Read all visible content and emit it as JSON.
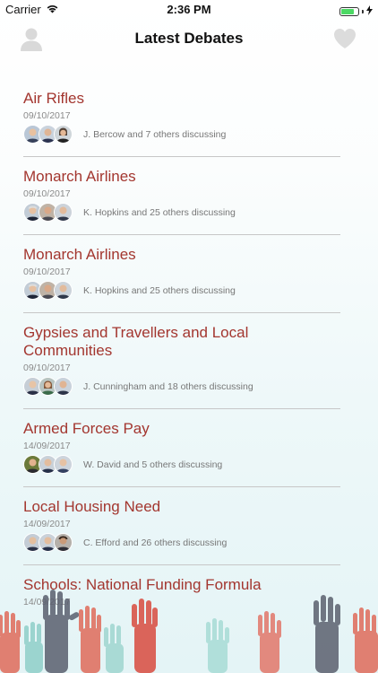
{
  "status_bar": {
    "carrier": "Carrier",
    "time": "2:36 PM",
    "battery_level": 0.8,
    "battery_color": "#4cd964"
  },
  "nav": {
    "title": "Latest Debates",
    "left_icon": "profile-icon",
    "right_icon": "heart-icon"
  },
  "colors": {
    "title": "#a3362f",
    "date": "#8a8a8a",
    "divider": "#c7c7c7"
  },
  "debates": [
    {
      "title": "Air Rifles",
      "date": "09/10/2017",
      "discussion": "J. Bercow and 7 others discussing"
    },
    {
      "title": "Monarch Airlines",
      "date": "09/10/2017",
      "discussion": "K. Hopkins and 25 others discussing"
    },
    {
      "title": "Monarch Airlines",
      "date": "09/10/2017",
      "discussion": "K. Hopkins and 25 others discussing"
    },
    {
      "title": "Gypsies and Travellers and Local Communities",
      "date": "09/10/2017",
      "discussion": "J. Cunningham and 18 others discussing"
    },
    {
      "title": "Armed Forces Pay",
      "date": "14/09/2017",
      "discussion": "W. David and 5 others discussing"
    },
    {
      "title": "Local Housing Need",
      "date": "14/09/2017",
      "discussion": "C. Efford and 26 others discussing"
    },
    {
      "title": "Schools: National Funding Formula",
      "date": "14/09/2017",
      "discussion": ""
    }
  ]
}
